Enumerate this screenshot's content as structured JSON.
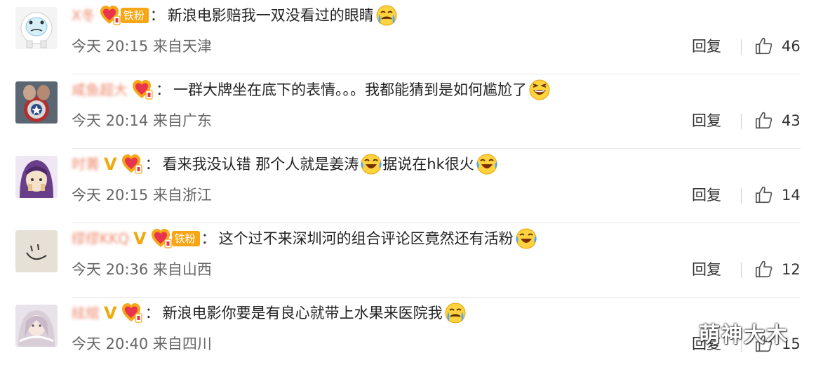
{
  "comments": [
    {
      "username": "Ⅹ冬",
      "verified": "",
      "fan_badge": "铁粉",
      "colon": "：",
      "text": "新浪电影赔我一双没看过的眼睛",
      "emoji": "crying-emoji",
      "time": "今天 20:15 来自天津",
      "reply": "回复",
      "likes": "46"
    },
    {
      "username": "咸鱼超大",
      "verified": "",
      "fan_badge": "",
      "colon": "：",
      "text": "一群大牌坐在底下的表情。。。我都能猜到是如何尴尬了",
      "emoji": "laughing-emoji",
      "time": "今天 20:14 来自广东",
      "reply": "回复",
      "likes": "43"
    },
    {
      "username": "时菁",
      "verified": "V",
      "fan_badge": "",
      "colon": "：",
      "text": "看来我没认错 那个人就是姜涛",
      "text2": "据说在hk很火",
      "emoji": "tears-of-joy-emoji",
      "time": "今天 20:15 来自浙江",
      "reply": "回复",
      "likes": "14"
    },
    {
      "username": "缪缪KKQ",
      "verified": "V",
      "fan_badge": "铁粉",
      "colon": "：",
      "text": "这个过不来深圳河的组合评论区竟然还有活粉",
      "emoji": "tears-of-joy-emoji",
      "time": "今天 20:36 来自山西",
      "reply": "回复",
      "likes": "12"
    },
    {
      "username": "絃绾",
      "verified": "V",
      "fan_badge": "",
      "colon": "：",
      "text": "新浪电影你要是有良心就带上水果来医院我",
      "emoji": "crying-emoji",
      "time": "今天 20:40 来自四川",
      "reply": "回复",
      "likes": "15"
    }
  ],
  "watermark": "萌神大木",
  "colors": {
    "username": "#eb7350",
    "fan_badge_bg": "#f7a615",
    "verified": "#f0a90f",
    "meta": "#666666"
  }
}
